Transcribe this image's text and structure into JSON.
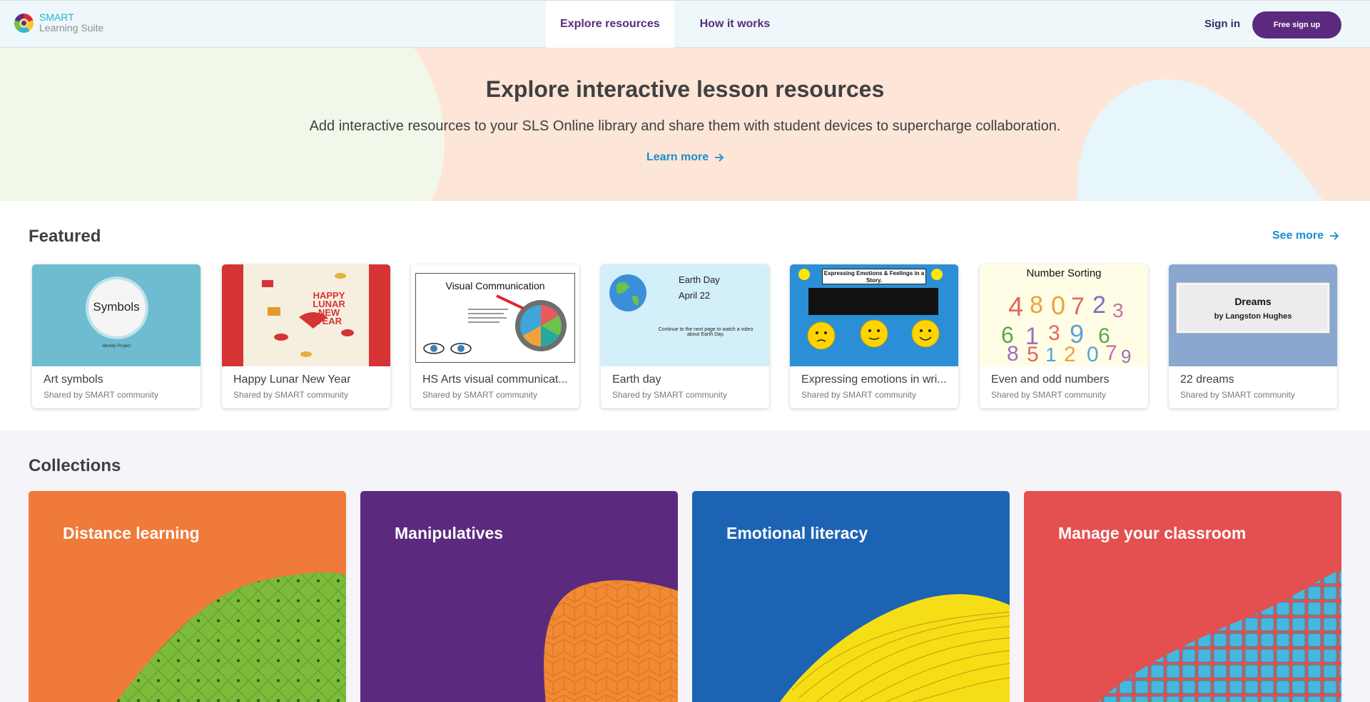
{
  "header": {
    "logo_line1": "SMART",
    "logo_line2": "Learning Suite",
    "nav": [
      {
        "label": "Explore resources",
        "active": true
      },
      {
        "label": "How it works",
        "active": false
      }
    ],
    "sign_in": "Sign in",
    "signup": "Free sign up"
  },
  "hero": {
    "title": "Explore interactive lesson resources",
    "subtitle": "Add interactive resources to your SLS Online library and share them with student devices to supercharge collaboration.",
    "learn_more": "Learn more"
  },
  "featured": {
    "title": "Featured",
    "see_more": "See more",
    "cards": [
      {
        "title": "Art symbols",
        "sub": "Shared by SMART community",
        "thumb": {
          "heading": "Symbols",
          "caption": "Identity Project"
        }
      },
      {
        "title": "Happy Lunar New Year",
        "sub": "Shared by SMART community",
        "thumb": {
          "line1": "HAPPY",
          "line2": "LUNAR",
          "line3": "NEW",
          "line4": "YEAR"
        }
      },
      {
        "title": "HS Arts visual communicat...",
        "sub": "Shared by SMART community",
        "thumb": {
          "heading": "Visual Communication"
        }
      },
      {
        "title": "Earth day",
        "sub": "Shared by SMART community",
        "thumb": {
          "line1": "Earth Day",
          "line2": "April 22",
          "note": "Continue to the next page to watch a video about Earth Day."
        }
      },
      {
        "title": "Expressing emotions in wri...",
        "sub": "Shared by SMART community",
        "thumb": {
          "heading": "Expressing Emotions & Feelings in a Story."
        }
      },
      {
        "title": "Even and odd numbers",
        "sub": "Shared by SMART community",
        "thumb": {
          "heading": "Number Sorting"
        }
      },
      {
        "title": "22 dreams",
        "sub": "Shared by SMART community",
        "thumb": {
          "line1": "Dreams",
          "line2": "by Langston Hughes"
        }
      }
    ]
  },
  "collections": {
    "title": "Collections",
    "items": [
      {
        "label": "Distance learning",
        "color": "#ef7a39",
        "accent": "#7dbb3a"
      },
      {
        "label": "Manipulatives",
        "color": "#5b2a7e",
        "accent": "#f08a34"
      },
      {
        "label": "Emotional literacy",
        "color": "#1d63b3",
        "accent": "#f6de16"
      },
      {
        "label": "Manage your classroom",
        "color": "#e4504f",
        "accent": "#46b8df"
      }
    ]
  }
}
